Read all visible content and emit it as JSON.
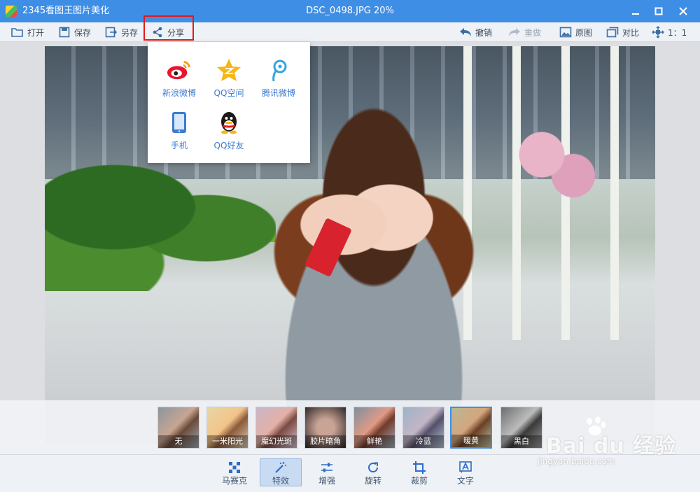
{
  "window": {
    "app_title": "2345看图王图片美化",
    "document_title": "DSC_0498.JPG  20%",
    "controls": [
      "minimize",
      "maximize",
      "close"
    ]
  },
  "toolbar": {
    "left": [
      {
        "label": "打开",
        "icon": "folder-open-icon"
      },
      {
        "label": "保存",
        "icon": "save-icon"
      },
      {
        "label": "另存",
        "icon": "save-as-icon"
      },
      {
        "label": "分享",
        "icon": "share-icon",
        "highlighted": true
      }
    ],
    "right": [
      {
        "label": "撤销",
        "icon": "undo-icon",
        "enabled": true
      },
      {
        "label": "重做",
        "icon": "redo-icon",
        "enabled": false
      },
      {
        "label": "原图",
        "icon": "original-image-icon",
        "enabled": true
      },
      {
        "label": "对比",
        "icon": "compare-icon",
        "enabled": true
      },
      {
        "label": "1：1",
        "icon": "actual-size-icon",
        "enabled": true
      }
    ]
  },
  "share_menu": {
    "items": [
      {
        "label": "新浪微博",
        "icon": "sina-weibo-icon"
      },
      {
        "label": "QQ空间",
        "icon": "qzone-icon"
      },
      {
        "label": "腾讯微博",
        "icon": "tencent-weibo-icon"
      },
      {
        "label": "手机",
        "icon": "phone-icon"
      },
      {
        "label": "QQ好友",
        "icon": "qq-friend-icon"
      }
    ]
  },
  "filters": {
    "selected": "暖黄",
    "items": [
      "无",
      "一米阳光",
      "魔幻光斑",
      "胶片暗角",
      "鲜艳",
      "冷蓝",
      "暖黄",
      "黑白"
    ]
  },
  "bottom_nav": {
    "active": "特效",
    "items": [
      {
        "label": "马赛克",
        "icon": "mosaic-icon"
      },
      {
        "label": "特效",
        "icon": "magic-wand-icon"
      },
      {
        "label": "增强",
        "icon": "sliders-icon"
      },
      {
        "label": "旋转",
        "icon": "rotate-icon"
      },
      {
        "label": "裁剪",
        "icon": "crop-icon"
      },
      {
        "label": "文字",
        "icon": "text-icon"
      }
    ]
  },
  "watermark": {
    "brand": "Bai du 经验",
    "url": "jingyan.baidu.com"
  },
  "colors": {
    "titlebar": "#3f8ee6",
    "accent": "#2c6cc9",
    "highlight_box": "#e21b1b",
    "share_label": "#3c7bd1"
  }
}
